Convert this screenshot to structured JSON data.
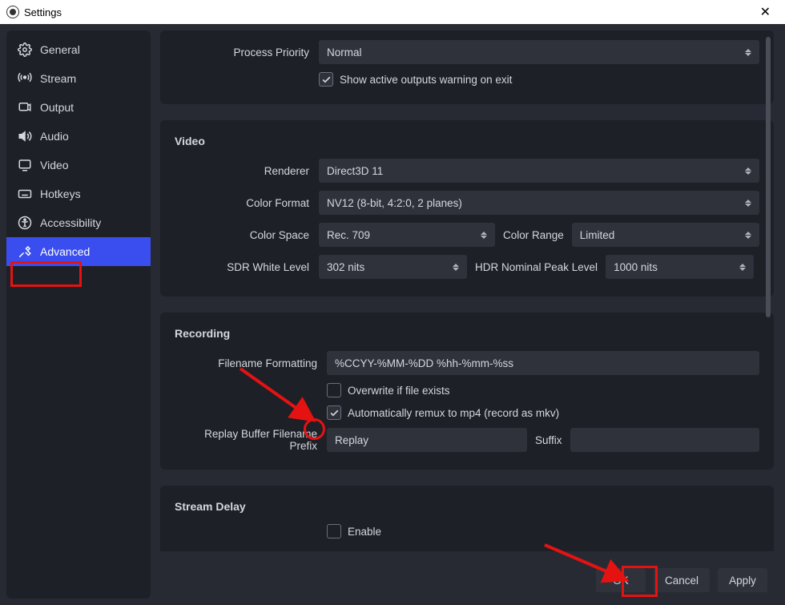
{
  "window": {
    "title": "Settings"
  },
  "sidebar": {
    "items": [
      {
        "label": "General"
      },
      {
        "label": "Stream"
      },
      {
        "label": "Output"
      },
      {
        "label": "Audio"
      },
      {
        "label": "Video"
      },
      {
        "label": "Hotkeys"
      },
      {
        "label": "Accessibility"
      },
      {
        "label": "Advanced"
      }
    ]
  },
  "general": {
    "priority_label": "Process Priority",
    "priority_value": "Normal",
    "show_active_outputs": "Show active outputs warning on exit"
  },
  "video": {
    "heading": "Video",
    "renderer_label": "Renderer",
    "renderer_value": "Direct3D 11",
    "color_format_label": "Color Format",
    "color_format_value": "NV12 (8-bit, 4:2:0, 2 planes)",
    "color_space_label": "Color Space",
    "color_space_value": "Rec. 709",
    "color_range_label": "Color Range",
    "color_range_value": "Limited",
    "sdr_label": "SDR White Level",
    "sdr_value": "302 nits",
    "hdr_label": "HDR Nominal Peak Level",
    "hdr_value": "1000 nits"
  },
  "recording": {
    "heading": "Recording",
    "filename_label": "Filename Formatting",
    "filename_value": "%CCYY-%MM-%DD %hh-%mm-%ss",
    "overwrite": "Overwrite if file exists",
    "automux": "Automatically remux to mp4 (record as mkv)",
    "replay_prefix_label": "Replay Buffer Filename Prefix",
    "replay_prefix_value": "Replay",
    "suffix_label": "Suffix"
  },
  "stream_delay": {
    "heading": "Stream Delay",
    "enable": "Enable"
  },
  "footer": {
    "ok": "OK",
    "cancel": "Cancel",
    "apply": "Apply"
  }
}
